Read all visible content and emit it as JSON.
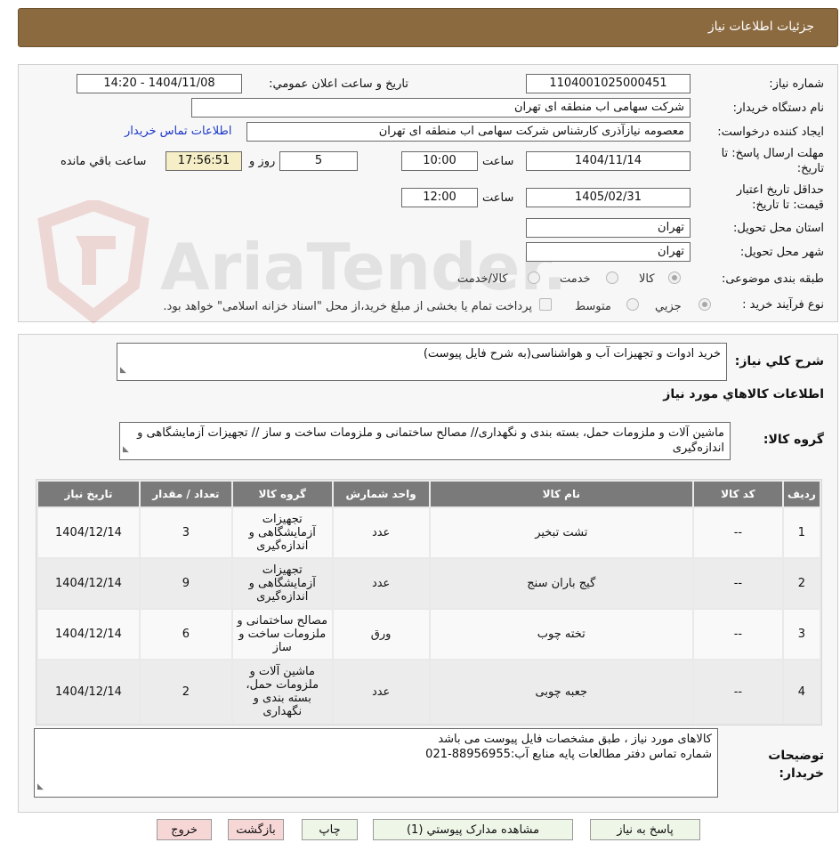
{
  "header": {
    "title": "جزئیات اطلاعات نیاز"
  },
  "watermark": {
    "text": "AriaTender.neT"
  },
  "form": {
    "need_number_label": "شماره نیاز:",
    "need_number": "1104001025000451",
    "announce_label": "تاریخ و ساعت اعلان عمومي:",
    "announce_value": "1404/11/08 - 14:20",
    "buyer_label": "نام دستگاه خریدار:",
    "buyer_value": "شرکت سهامی اب منطقه ای تهران",
    "creator_label": "ایجاد کننده درخواست:",
    "creator_value": "معصومه نیازآذری کارشناس شرکت سهامی اب منطقه ای تهران",
    "contact_link": "اطلاعات تماس خریدار",
    "deadline_label": "مهلت ارسال پاسخ: تا تاریخ:",
    "deadline_date": "1404/11/14",
    "time_label": "ساعت",
    "deadline_time": "10:00",
    "days_value": "5",
    "days_label": "روز و",
    "remaining_time": "17:56:51",
    "remaining_label": "ساعت باقي مانده",
    "validity_label": "حداقل تاریخ اعتبار قیمت: تا تاریخ:",
    "validity_date": "1405/02/31",
    "validity_time": "12:00",
    "province_label": "استان محل تحویل:",
    "province_value": "تهران",
    "city_label": "شهر محل تحویل:",
    "city_value": "تهران",
    "category_label": "طبقه بندی موضوعی:",
    "category_options": [
      "کالا",
      "خدمت",
      "کالا/خدمت"
    ],
    "purchase_label": "نوع فرآیند خرید :",
    "purchase_options": [
      "جزیي",
      "متوسط"
    ],
    "purchase_note": "پرداخت تمام یا بخشی از مبلغ خرید،از محل \"اسناد خزانه اسلامی\" خواهد بود."
  },
  "summary": {
    "label": "شرح کلي نیاز:",
    "value": "خرید ادوات و تجهیزات آب و هواشناسی(به شرح فایل پیوست)"
  },
  "goods_section": {
    "title": "اطلاعات کالاهاي مورد نیاز",
    "group_label": "گروه کالا:",
    "group_value": "ماشین آلات و ملزومات حمل، بسته بندی و نگهداری// مصالح ساختمانی و ملزومات ساخت و ساز // تجهیزات آزمایشگاهی و اندازه‌گیری"
  },
  "table": {
    "headers": [
      "ردیف",
      "کد کالا",
      "نام کالا",
      "واحد شمارش",
      "گروه کالا",
      "تعداد / مقدار",
      "تاریخ نیاز"
    ],
    "rows": [
      {
        "row": "1",
        "code": "--",
        "name": "تشت تبخیر",
        "unit": "عدد",
        "group": "تجهیزات آزمایشگاهی و اندازه‌گیری",
        "qty": "3",
        "date": "1404/12/14"
      },
      {
        "row": "2",
        "code": "--",
        "name": "گیج باران سنج",
        "unit": "عدد",
        "group": "تجهیزات آزمایشگاهی و اندازه‌گیری",
        "qty": "9",
        "date": "1404/12/14"
      },
      {
        "row": "3",
        "code": "--",
        "name": "تخته چوب",
        "unit": "ورق",
        "group": "مصالح ساختمانی و ملزومات ساخت و ساز",
        "qty": "6",
        "date": "1404/12/14"
      },
      {
        "row": "4",
        "code": "--",
        "name": "جعبه چوبی",
        "unit": "عدد",
        "group": "ماشین آلات و ملزومات حمل، بسته بندی و نگهداری",
        "qty": "2",
        "date": "1404/12/14"
      }
    ]
  },
  "notes": {
    "label": "توضیحات خریدار:",
    "line1": "کالاهای مورد نیاز ، طبق مشخصات فایل پیوست می باشد",
    "line2": "شماره تماس دفتر مطالعات پایه منابع آب:88956955-021"
  },
  "buttons": {
    "reply": "پاسخ به نیاز",
    "attachments": "مشاهده مدارک پیوستي (1)",
    "print": "چاپ",
    "back": "بازگشت",
    "exit": "خروج"
  }
}
